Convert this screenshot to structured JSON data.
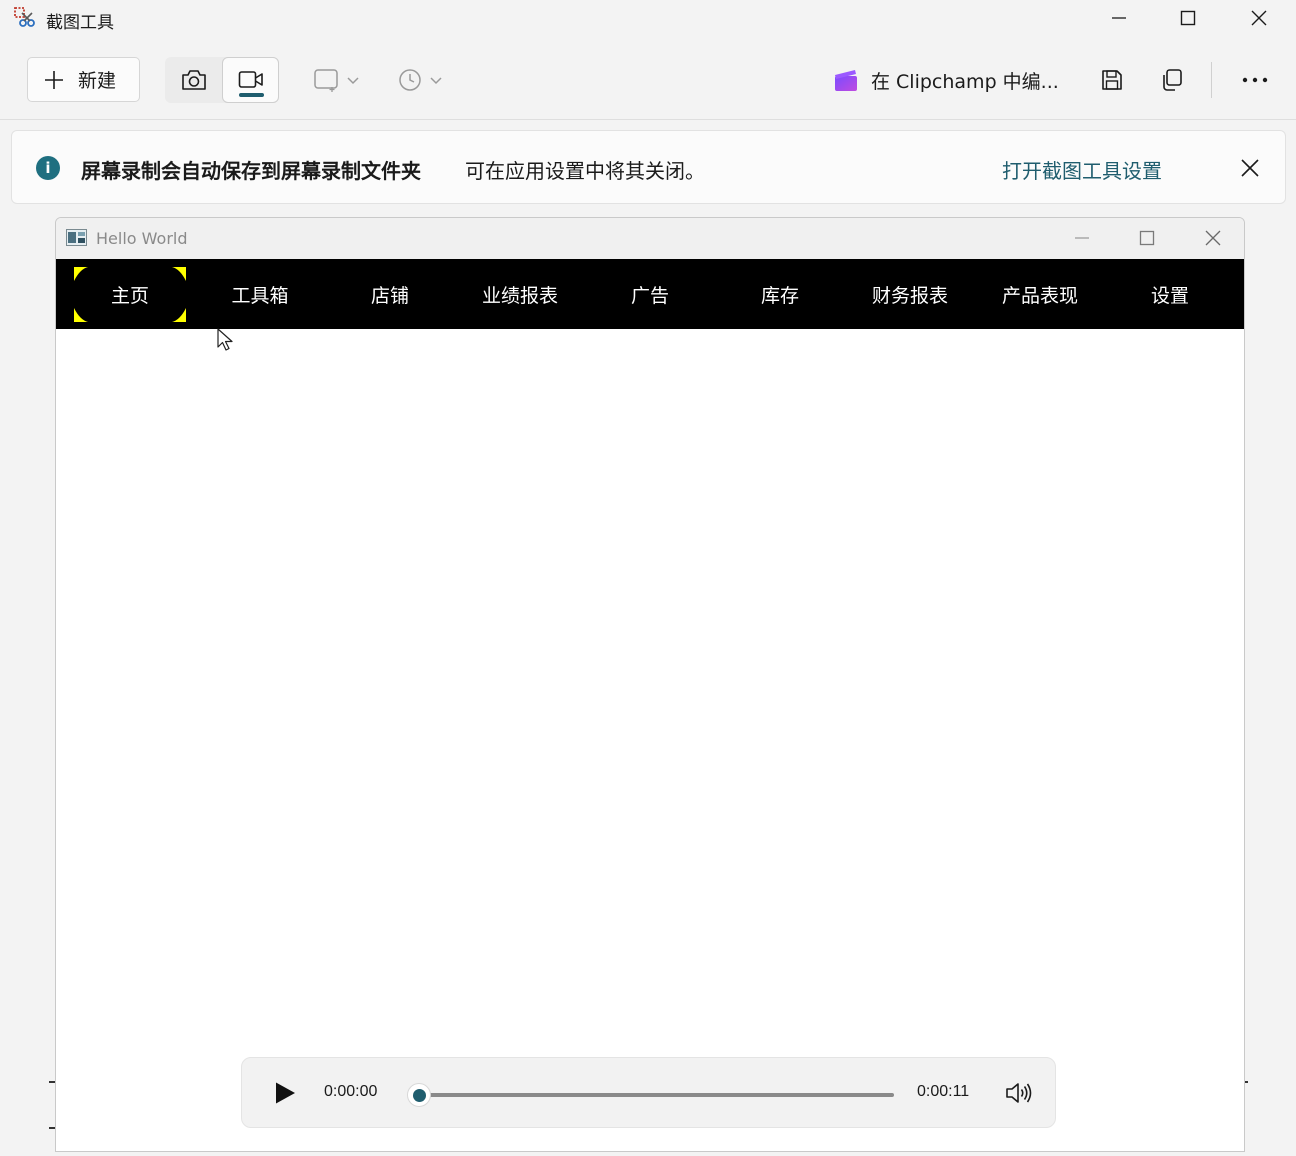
{
  "app": {
    "title": "截图工具"
  },
  "toolbar": {
    "new_label": "新建",
    "clipchamp_label": "在 Clipchamp 中编..."
  },
  "infobar": {
    "title": "屏幕录制会自动保存到屏幕录制文件夹",
    "message": "可在应用设置中将其关闭。",
    "link": "打开截图工具设置"
  },
  "window": {
    "title": "Hello World"
  },
  "nav": {
    "items": [
      "主页",
      "工具箱",
      "店铺",
      "业绩报表",
      "广告",
      "库存",
      "财务报表",
      "产品表现",
      "设置"
    ],
    "active_index": 0
  },
  "player": {
    "current_time": "0:00:00",
    "total_time": "0:00:11",
    "progress": 0
  },
  "colors": {
    "accent": "#1f5d6e",
    "nav_bg": "#000000",
    "nav_highlight": "#ffff00"
  }
}
